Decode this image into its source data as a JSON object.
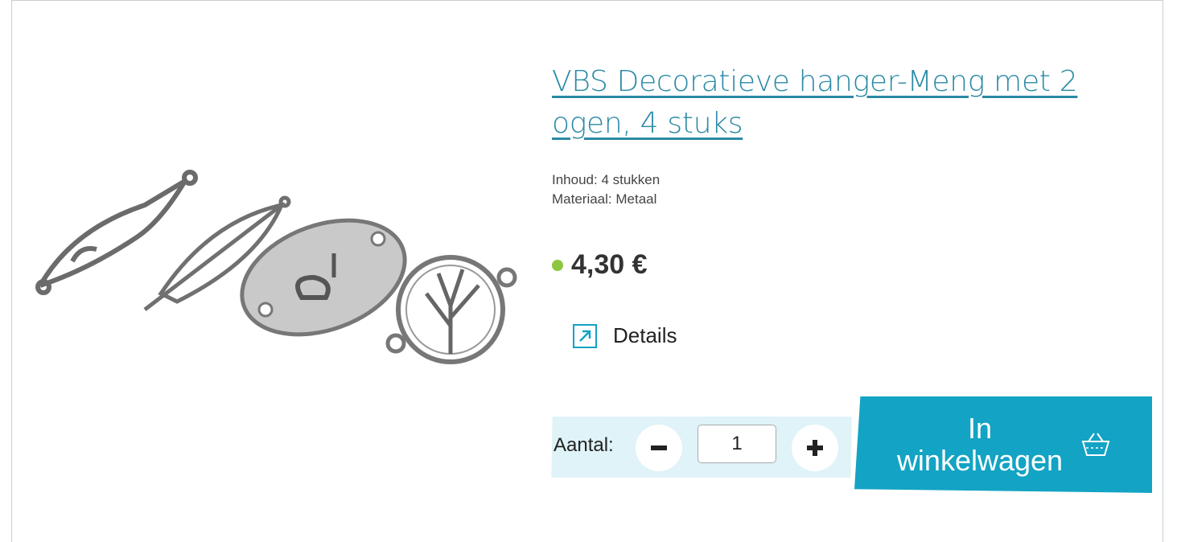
{
  "product": {
    "title": "VBS Decoratieve hanger-Meng met 2 ogen, 4 stuks",
    "specs": [
      "Inhoud: 4 stukken",
      "Materiaal: Metaal"
    ],
    "price": "4,30 €",
    "stock_color": "#8dc63f"
  },
  "details": {
    "label": "Details",
    "icon": "external-link-icon"
  },
  "quantity": {
    "label": "Aantal:",
    "value": "1",
    "minus_icon": "minus-icon",
    "plus_icon": "plus-icon"
  },
  "cart": {
    "label": "In\nwinkelwagen",
    "icon": "basket-icon"
  },
  "colors": {
    "accent": "#13a3c4",
    "link": "#2b8aa5",
    "qty_bg": "#dff3f8"
  }
}
